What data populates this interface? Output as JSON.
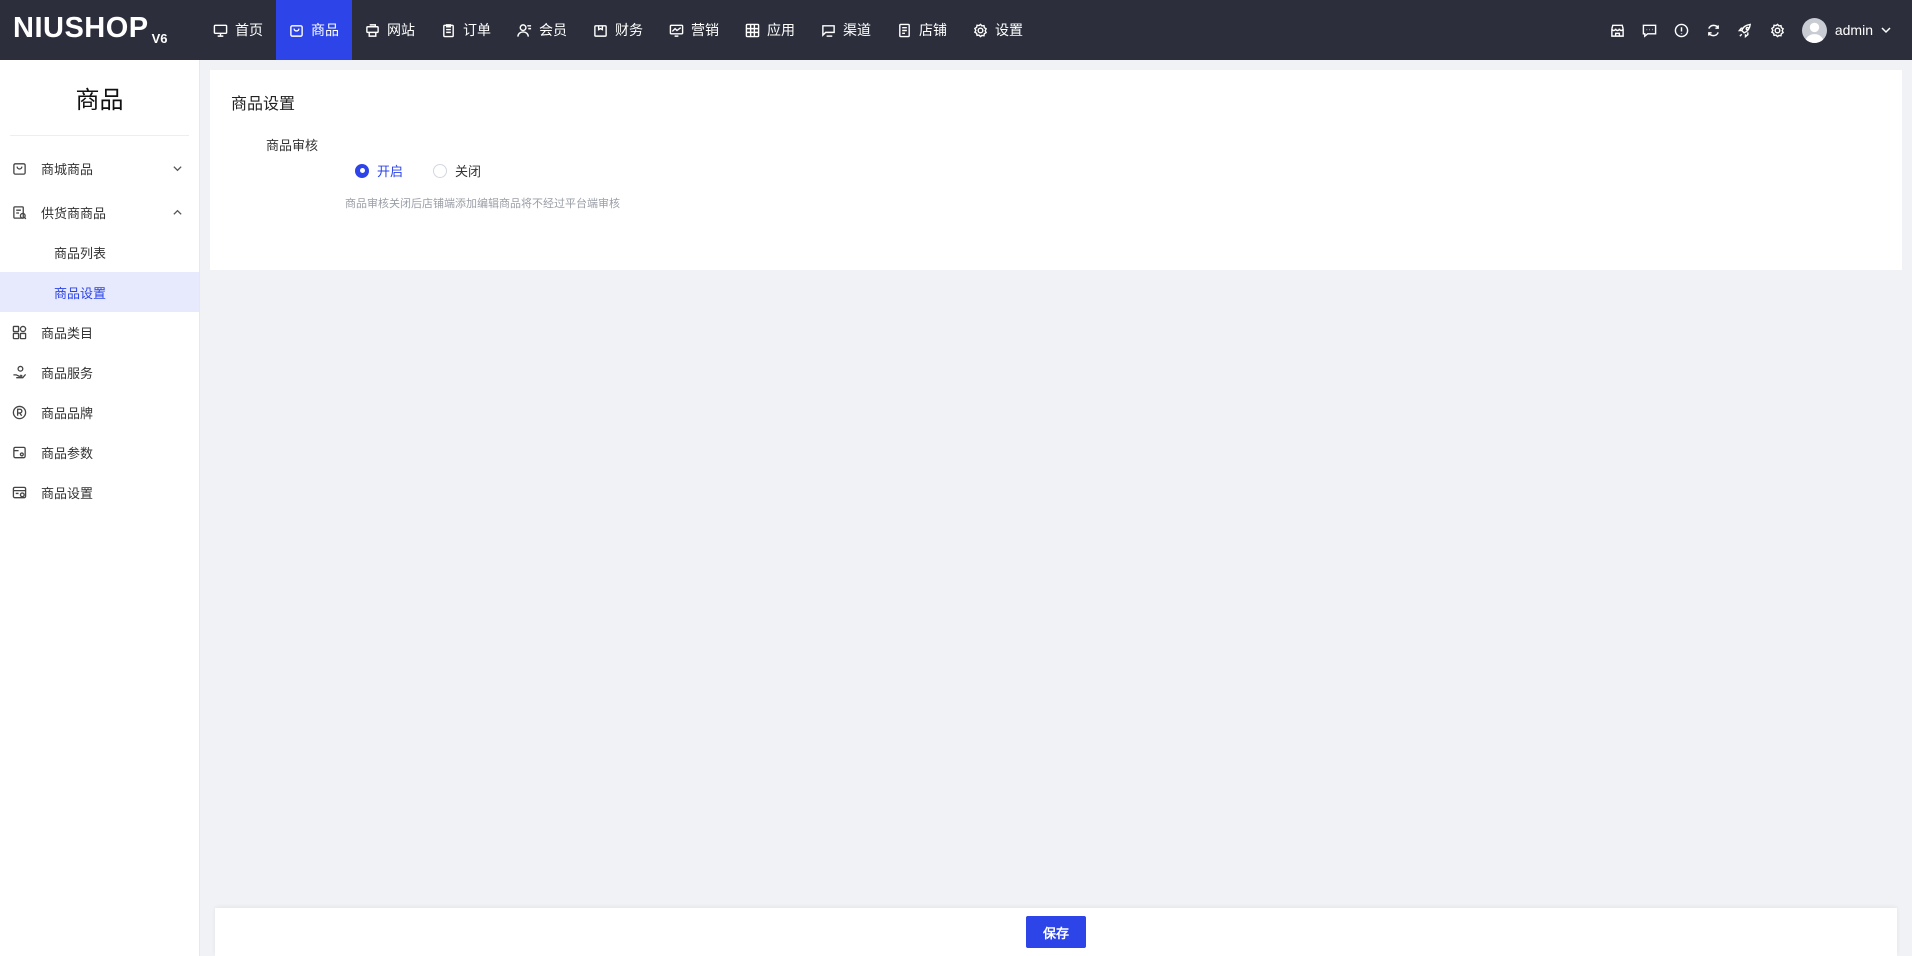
{
  "brand": {
    "name": "NIUSHOP",
    "version": "V6"
  },
  "nav": {
    "items": [
      {
        "label": "首页",
        "icon": "monitor-icon"
      },
      {
        "label": "商品",
        "icon": "bag-icon",
        "active": true
      },
      {
        "label": "网站",
        "icon": "printer-icon"
      },
      {
        "label": "订单",
        "icon": "clipboard-icon"
      },
      {
        "label": "会员",
        "icon": "user-icon"
      },
      {
        "label": "财务",
        "icon": "wallet-icon"
      },
      {
        "label": "营销",
        "icon": "chart-icon"
      },
      {
        "label": "应用",
        "icon": "grid-icon"
      },
      {
        "label": "渠道",
        "icon": "channel-icon"
      },
      {
        "label": "店铺",
        "icon": "store-doc-icon"
      },
      {
        "label": "设置",
        "icon": "gear-icon"
      }
    ]
  },
  "toolbar": {
    "icons": [
      "shop-icon",
      "message-icon",
      "info-icon",
      "refresh-icon",
      "rocket-icon",
      "settings-icon"
    ],
    "user": "admin"
  },
  "sidebar": {
    "title": "商品",
    "items": [
      {
        "label": "商城商品",
        "icon": "bag-icon",
        "expand": "down"
      },
      {
        "label": "供货商商品",
        "icon": "supply-icon",
        "expand": "up"
      },
      {
        "label": "商品列表",
        "sub": true
      },
      {
        "label": "商品设置",
        "sub": true,
        "active": true
      },
      {
        "label": "商品类目",
        "icon": "category-icon"
      },
      {
        "label": "商品服务",
        "icon": "service-icon"
      },
      {
        "label": "商品品牌",
        "icon": "brand-icon"
      },
      {
        "label": "商品参数",
        "icon": "param-icon"
      },
      {
        "label": "商品设置",
        "icon": "goods-setting-icon"
      }
    ]
  },
  "main": {
    "title": "商品设置",
    "field_label": "商品审核",
    "options": [
      {
        "label": "开启",
        "checked": true
      },
      {
        "label": "关闭",
        "checked": false
      }
    ],
    "hint": "商品审核关闭后店铺端添加编辑商品将不经过平台端审核"
  },
  "footer": {
    "save_label": "保存"
  },
  "colors": {
    "primary": "#2c44e8",
    "topbar": "#2c2f3b"
  }
}
